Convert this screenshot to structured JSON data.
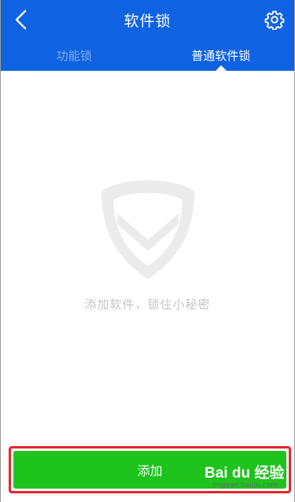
{
  "header": {
    "title": "软件锁",
    "back_icon": "chevron-left-icon",
    "settings_icon": "gear-icon"
  },
  "tabs": [
    {
      "label": "功能锁",
      "active": false
    },
    {
      "label": "普通软件锁",
      "active": true
    }
  ],
  "empty_state": {
    "icon": "shield-logo-icon",
    "message": "添加软件，锁住小秘密"
  },
  "add_button": {
    "label": "添加",
    "highlight_color": "#e8232f"
  },
  "watermark": {
    "logo_text": "Bai du 经验",
    "url": "jingyan.baidu.com"
  },
  "colors": {
    "brand_blue": "#0f63e2",
    "action_green": "#1ec31e"
  }
}
